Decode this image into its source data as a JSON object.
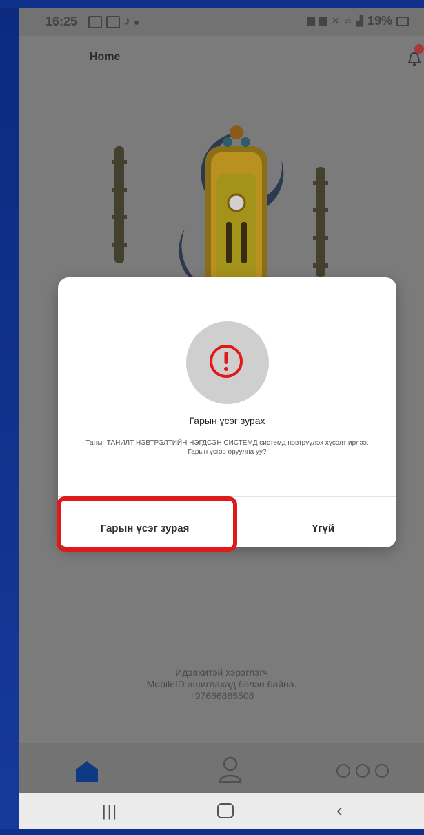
{
  "status_bar": {
    "time": "16:25",
    "battery": "19%"
  },
  "header": {
    "title": "Home"
  },
  "dialog": {
    "title": "Гарын үсэг зурах",
    "message": "Таныг ТАНИЛТ НЭВТРЭЛТИЙН НЭГДСЭН СИСТЕМД системд нэвтрүүлэх хүсэлт ирлээ. Гарын үсгээ оруулна уу?",
    "confirm_label": "Гарын үсэг зурая",
    "cancel_label": "Үгүй",
    "icon": "alert-circle-icon"
  },
  "background_info": {
    "line1": "Идэвхитэй хэрэглэгч",
    "line2": "MobileID ашиглахад бэлэн байна.",
    "phone": "+97686885508"
  },
  "bottom_nav": {
    "items": [
      {
        "icon": "home-icon",
        "active": true
      },
      {
        "icon": "user-icon",
        "active": false
      },
      {
        "icon": "more-icon",
        "active": false
      }
    ]
  },
  "colors": {
    "accent_home": "#0d3a82",
    "alert_red": "#e01a1a",
    "highlight": "#e01a1a"
  }
}
